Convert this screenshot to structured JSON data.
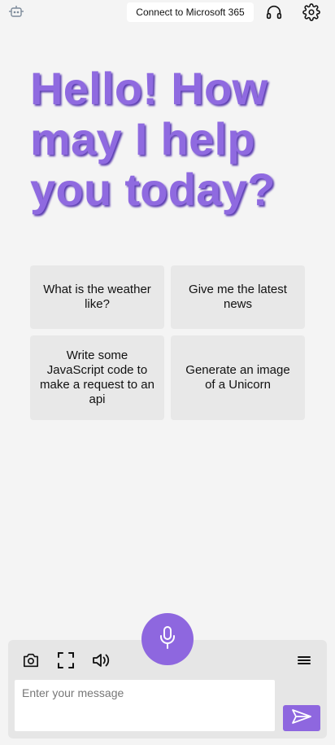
{
  "header": {
    "logo_icon": "bot-logo-icon",
    "connect_label": "Connect to Microsoft 365",
    "headset_icon": "headset-icon",
    "settings_icon": "gear-icon"
  },
  "greeting": "Hello! How may I help you today?",
  "suggestions": [
    "What is the weather like?",
    "Give me the latest news",
    "Write some JavaScript code to make a request to an api",
    "Generate an image of a Unicorn"
  ],
  "composer": {
    "placeholder": "Enter your message",
    "mic_icon": "microphone-icon",
    "tools": [
      "camera-icon",
      "fullscreen-icon",
      "speaker-icon",
      "menu-icon"
    ],
    "send_icon": "send-icon"
  },
  "colors": {
    "accent": "#8e67df",
    "greeting_text": "#8f6ae0",
    "background": "#f4f4f4",
    "card_background": "#e8e8e8"
  }
}
